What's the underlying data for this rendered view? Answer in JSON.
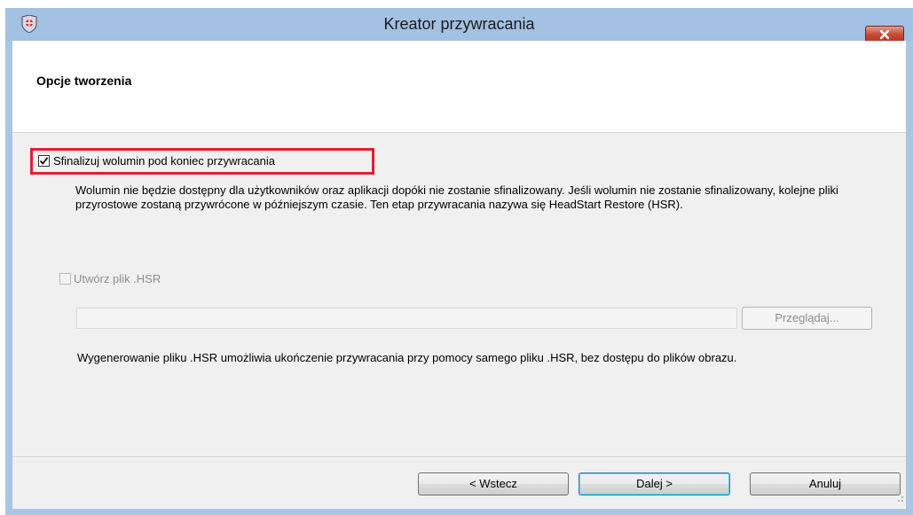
{
  "window": {
    "title": "Kreator przywracania",
    "app_icon": "shield-icon",
    "close_icon": "close-icon"
  },
  "header": {
    "title": "Opcje tworzenia"
  },
  "options": {
    "finalize": {
      "label": "Sfinalizuj wolumin pod koniec przywracania",
      "checked": true,
      "enabled": true,
      "description": "Wolumin nie będzie dostępny dla użytkowników oraz aplikacji dopóki nie zostanie sfinalizowany. Jeśli wolumin nie zostanie sfinalizowany, kolejne pliki przyrostowe zostaną przywrócone w późniejszym czasie. Ten etap przywracania nazywa się HeadStart Restore (HSR)."
    },
    "create_hsr": {
      "label": "Utwórz plik .HSR",
      "checked": false,
      "enabled": false,
      "path_value": "",
      "browse_label": "Przeglądaj...",
      "note": "Wygenerowanie pliku .HSR umożliwia ukończenie przywracania przy pomocy samego pliku .HSR, bez dostępu do plików obrazu."
    }
  },
  "footer": {
    "back_label": "< Wstecz",
    "next_label": "Dalej >",
    "cancel_label": "Anuluj"
  },
  "colors": {
    "highlight": "#e0202e",
    "titlebar": "#a3c1e2",
    "close_button": "#c54b37"
  }
}
